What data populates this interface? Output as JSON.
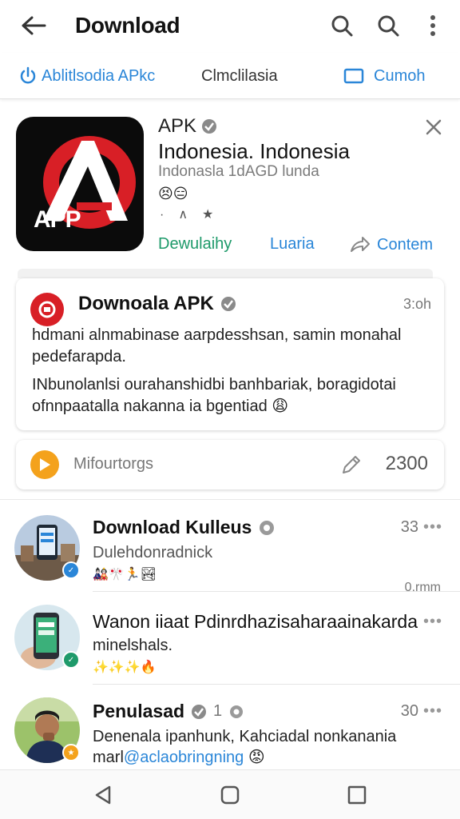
{
  "header": {
    "title": "Download",
    "icons": [
      "back-arrow-icon",
      "search-icon",
      "search-icon",
      "more-vertical-icon"
    ]
  },
  "tabs": [
    {
      "label": "Ablitlsodia APkc",
      "icon": "power-icon",
      "color": "#2a86d8"
    },
    {
      "label": "Clmclilasia",
      "icon": "",
      "color": "#333333"
    },
    {
      "label": "Cumoh",
      "icon": "folder-icon",
      "color": "#2a86d8"
    }
  ],
  "app": {
    "logo_text": "APP",
    "type": "APK",
    "name": "Indonesia. Indonesia",
    "subtitle": "Indonasla 1dAGD lunda",
    "emojis": "😣😑",
    "marks": "·∧★",
    "actions": {
      "primary": "Dewulaihy",
      "secondary": "Luaria",
      "tertiary": "Contem"
    },
    "accent_colors": {
      "green": "#1e9a6a",
      "blue": "#2a86d8",
      "logo_red": "#d81f26"
    }
  },
  "post": {
    "title": "Downoala APK",
    "time": "3:oh",
    "text1": "hdmani alnmabinase aarpdesshsan, samin monahal pedefarapda.",
    "text2": "INbunolanlsi ourahanshidbi banhbariak, boragidotai ofnnpaatalla nakanna ia bgentiad 😩"
  },
  "stat": {
    "label": "Mifourtorgs",
    "count": "2300"
  },
  "feed": [
    {
      "title": "Download Kulleus",
      "time": "33",
      "text": "Dulehdonradnick",
      "emoji": "🎎🎌🏃🏞",
      "footer": "0.rmm",
      "badge_color": "#2a86d8"
    },
    {
      "title": "Wanon iiaat Pdinrdhazisaharaainakarda",
      "time": "",
      "text": "minelshals.",
      "emoji": "✨✨✨🔥",
      "footer": "",
      "badge_color": "#1e9a6a"
    },
    {
      "title": "Penulasad",
      "title_extra": "1",
      "time": "30",
      "text": "Denenala ipanhunk, Kahciadal nonkanania",
      "text_tail": "marl",
      "mention": "@aclaobringning",
      "emoji_tail": "😡",
      "badge_color": "#f4a21c"
    }
  ],
  "navbar": [
    "back-triangle-icon",
    "home-square-icon",
    "recents-square-icon"
  ]
}
